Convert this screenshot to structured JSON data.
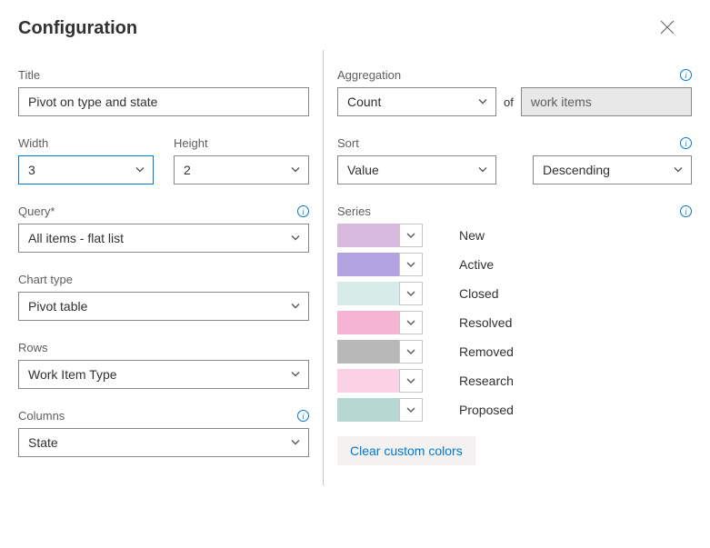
{
  "header": {
    "title": "Configuration"
  },
  "left": {
    "title_label": "Title",
    "title_value": "Pivot on type and state",
    "width_label": "Width",
    "width_value": "3",
    "height_label": "Height",
    "height_value": "2",
    "query_label": "Query*",
    "query_value": "All items - flat list",
    "chart_type_label": "Chart type",
    "chart_type_value": "Pivot table",
    "rows_label": "Rows",
    "rows_value": "Work Item Type",
    "columns_label": "Columns",
    "columns_value": "State"
  },
  "right": {
    "aggregation_label": "Aggregation",
    "aggregation_value": "Count",
    "of_text": "of",
    "aggregation_target": "work items",
    "sort_label": "Sort",
    "sort_value": "Value",
    "sort_direction": "Descending",
    "series_label": "Series",
    "series": [
      {
        "label": "New",
        "color": "#d6b9dd"
      },
      {
        "label": "Active",
        "color": "#b3a3e0"
      },
      {
        "label": "Closed",
        "color": "#d7ece8"
      },
      {
        "label": "Resolved",
        "color": "#f5b4d3"
      },
      {
        "label": "Removed",
        "color": "#b8b8b8"
      },
      {
        "label": "Research",
        "color": "#fbd1e6"
      },
      {
        "label": "Proposed",
        "color": "#b7d8d2"
      }
    ],
    "clear_colors": "Clear custom colors"
  }
}
